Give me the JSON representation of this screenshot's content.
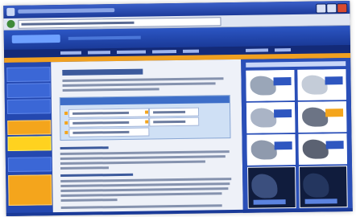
{
  "photo": {
    "description_visible_text": []
  }
}
